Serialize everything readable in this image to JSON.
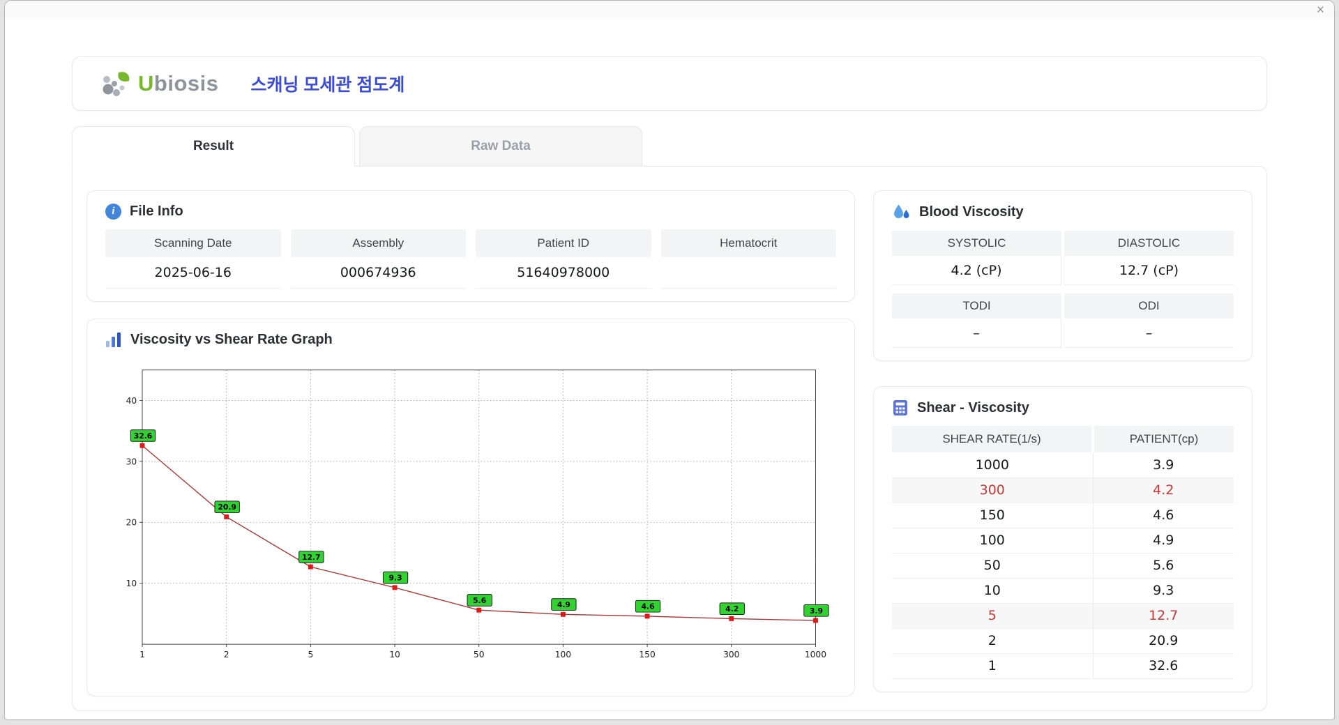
{
  "window": {
    "close_icon": "×"
  },
  "icons": {
    "info": "i"
  },
  "colors": {
    "accent_title": "#3c4bd8",
    "highlight": "#d03434",
    "icon_blue": "#4285dd",
    "logo_green": "#76b82a",
    "logo_gray": "#8d939b"
  },
  "header": {
    "logo_u": "U",
    "logo_rest": "biosis",
    "title": "스캐닝 모세관 점도계"
  },
  "tabs": [
    {
      "label": "Result",
      "active": true
    },
    {
      "label": "Raw Data",
      "active": false
    }
  ],
  "file_info": {
    "title": "File Info",
    "fields": [
      {
        "label": "Scanning Date",
        "value": "2025-06-16"
      },
      {
        "label": "Assembly",
        "value": "000674936"
      },
      {
        "label": "Patient ID",
        "value": "51640978000"
      },
      {
        "label": "Hematocrit",
        "value": ""
      }
    ]
  },
  "graph": {
    "title": "Viscosity vs Shear Rate Graph"
  },
  "blood_viscosity": {
    "title": "Blood Viscosity",
    "groups": [
      {
        "cols": [
          {
            "label": "SYSTOLIC",
            "value": "4.2 (cP)"
          },
          {
            "label": "DIASTOLIC",
            "value": "12.7 (cP)"
          }
        ]
      },
      {
        "cols": [
          {
            "label": "TODI",
            "value": "–"
          },
          {
            "label": "ODI",
            "value": "–"
          }
        ]
      }
    ]
  },
  "shear_viscosity": {
    "title": "Shear - Viscosity",
    "columns": [
      "SHEAR RATE(1/s)",
      "PATIENT(cp)"
    ],
    "rows": [
      {
        "shear": "1000",
        "patient": "3.9",
        "highlight": false
      },
      {
        "shear": "300",
        "patient": "4.2",
        "highlight": true
      },
      {
        "shear": "150",
        "patient": "4.6",
        "highlight": false
      },
      {
        "shear": "100",
        "patient": "4.9",
        "highlight": false
      },
      {
        "shear": "50",
        "patient": "5.6",
        "highlight": false
      },
      {
        "shear": "10",
        "patient": "9.3",
        "highlight": false
      },
      {
        "shear": "5",
        "patient": "12.7",
        "highlight": true
      },
      {
        "shear": "2",
        "patient": "20.9",
        "highlight": false
      },
      {
        "shear": "1",
        "patient": "32.6",
        "highlight": false
      }
    ]
  },
  "chart_data": {
    "type": "line",
    "title": "Viscosity vs Shear Rate Graph",
    "x": [
      "1",
      "2",
      "5",
      "10",
      "50",
      "100",
      "150",
      "300",
      "1000"
    ],
    "values": [
      32.6,
      20.9,
      12.7,
      9.3,
      5.6,
      4.9,
      4.6,
      4.2,
      3.9
    ],
    "xlabel": "",
    "ylabel": "",
    "yticks": [
      10,
      20,
      30,
      40
    ],
    "ylim": [
      0,
      45
    ],
    "x_axis_type": "categorical",
    "grid": true,
    "legend": false,
    "line_color": "#b23030",
    "marker_color": "#e01818",
    "label_bg": "#30d330",
    "label_border": "#1c1c1c"
  }
}
